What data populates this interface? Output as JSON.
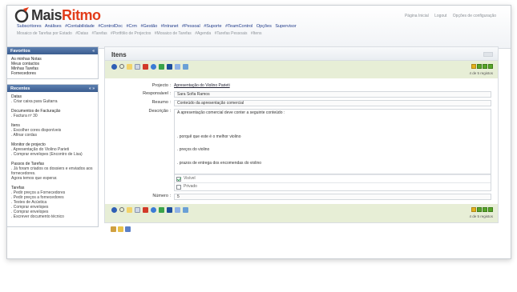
{
  "brand": {
    "name_prefix": "Mais",
    "name_suffix": "Ritmo"
  },
  "top_links": [
    "Página Inicial",
    "Logout",
    "Opções de configuração"
  ],
  "menu": [
    "Subscritores",
    "Análises",
    "#Contabilidade",
    "#ControlDoc",
    "#Crm",
    "#Gestão",
    "#Intranet",
    "#Pessoal",
    "#Suporte",
    "#TeamControl",
    "Opções",
    "Supervisor"
  ],
  "submenu": [
    "Mosaico de Tarefas por Estado",
    "#Datas",
    "#Tarefas",
    "#Portfólio de Projectos",
    "#Mosaico de Tarefas",
    "#Agenda",
    "#Tarefas Pessoais",
    "#Itens"
  ],
  "sidebar": {
    "favorites": {
      "title": "Favoritos",
      "ctrl": "«",
      "items": [
        "As minhas Notas",
        "Meus contactos",
        "Minhas Tarefas",
        "Fornecedores"
      ]
    },
    "recent": {
      "title": "Recentes",
      "ctrl": "« »",
      "groups": [
        {
          "title": "Datas",
          "items": [
            ". Criar caixa para Guitarra"
          ]
        },
        {
          "title": "Documentos de Facturação",
          "items": [
            ". Factura nº 30"
          ]
        },
        {
          "title": "Itens",
          "items": [
            ". Escolher cores disponíveis",
            ". Afinar cordas"
          ]
        },
        {
          "title": "Monitor de projecto",
          "items": [
            ". Apresentação do Violino Parieti",
            ". Comprar envelopes (Encontro de Lisa)"
          ]
        },
        {
          "title": "Passos de Tarefas",
          "items": [
            ". Já foram criados os dossiers e enviados aos fornecedores.",
            "Agora temos que esperar."
          ]
        },
        {
          "title": "Tarefas",
          "items": [
            ". Pedir preços a Fornecedores",
            ". Pedir preços a fornecedores",
            ". Testes de Acústica",
            ". Comprar envelopes",
            ". Comprar envelopes",
            ". Escrever documento técnico"
          ]
        }
      ]
    }
  },
  "main": {
    "title": "Itens",
    "pager_count": "4 de 5 registos",
    "fields": {
      "project_label": "Projecto :",
      "project_value": "Apresentação do Violino Parieti",
      "responsible_label": "Responsável :",
      "responsible_value": "Sara Sofia Ramos",
      "summary_label": "Resumo :",
      "summary_value": "Conteúdo da apresentação comercial",
      "description_label": "Descrição :",
      "description_lines": [
        "A apresentação comercial deve conter a seguinte conteúdo :",
        ". porquê que este é o melhor violino",
        ". preços do violino",
        ". prazos de entrega dos encomendas do violino"
      ],
      "check_visible_label": "Visível",
      "check_private_label": "Privado",
      "number_label": "Número :",
      "number_value": "5"
    }
  },
  "colors": {
    "logo_accent": "#e23c1a",
    "sidebar_header": "#3b5d8f",
    "toolbar_bg": "#e7eed6",
    "pager_green": "#58a629",
    "pager_yellow": "#e3b21b"
  },
  "icons": [
    "add-icon",
    "search-icon",
    "edit-icon",
    "copy-icon",
    "delete-icon",
    "refresh-icon",
    "pin-icon",
    "save-icon",
    "filter-icon",
    "export-icon"
  ]
}
